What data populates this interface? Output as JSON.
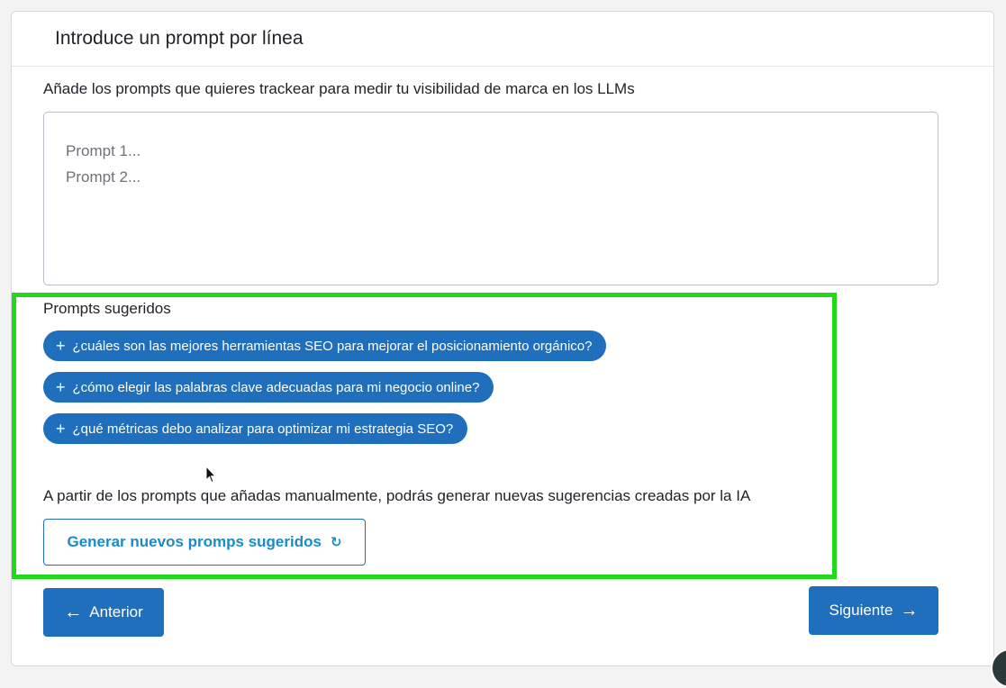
{
  "header": {
    "title": "Introduce un prompt por línea"
  },
  "description": "Añade los prompts que quieres trackear para medir tu visibilidad de marca en los LLMs",
  "prompt_input": {
    "value": "",
    "placeholder_line1": "Prompt 1...",
    "placeholder_line2": "Prompt 2..."
  },
  "suggested": {
    "title": "Prompts sugeridos",
    "plus_icon": "+",
    "items": [
      {
        "label": "¿cuáles son las mejores herramientas SEO para mejorar el posicionamiento orgánico?"
      },
      {
        "label": "¿cómo elegir las palabras clave adecuadas para mi negocio online?"
      },
      {
        "label": "¿qué métricas debo analizar para optimizar mi estrategia SEO?"
      }
    ],
    "helper_text": "A partir de los prompts que añadas manualmente, podrás generar nuevas sugerencias creadas por la IA",
    "generate_label": "Generar nuevos promps sugeridos",
    "refresh_icon": "↻"
  },
  "nav": {
    "prev_label": "Anterior",
    "prev_icon": "←",
    "next_label": "Siguiente",
    "next_icon": "→"
  },
  "colors": {
    "primary": "#1f6fbd",
    "link": "#1a8ac9",
    "highlight": "#22d81a"
  }
}
